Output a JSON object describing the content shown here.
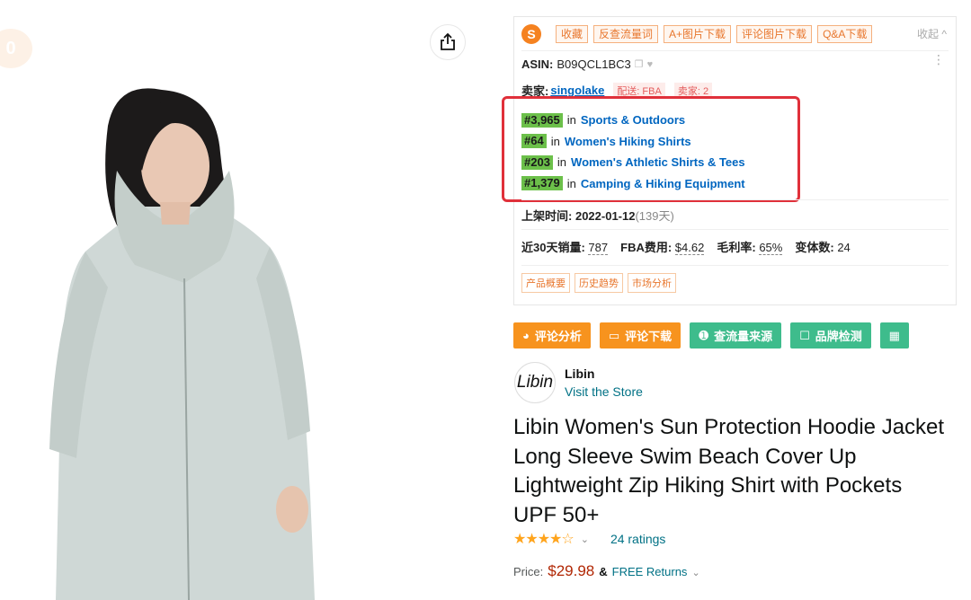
{
  "left": {
    "corner_badge": "0",
    "share_icon": "share-icon"
  },
  "plugin": {
    "logo": "S",
    "tools": [
      "收藏",
      "反查流量词",
      "A+图片下载",
      "评论图片下载",
      "Q&A下载"
    ],
    "collapse": "收起 ^",
    "asin_label": "ASIN:",
    "asin": "B09QCL1BC3",
    "seller_label": "卖家:",
    "seller": "singolake",
    "ship_tag": "配送: FBA",
    "sellers_tag": "卖家: 2",
    "ranks": [
      {
        "num": "#3,965",
        "in": "in",
        "cat": "Sports & Outdoors"
      },
      {
        "num": "#64",
        "in": "in",
        "cat": "Women's Hiking Shirts"
      },
      {
        "num": "#203",
        "in": "in",
        "cat": "Women's Athletic Shirts & Tees"
      },
      {
        "num": "#1,379",
        "in": "in",
        "cat": "Camping & Hiking Equipment"
      }
    ],
    "list_date_label": "上架时间:",
    "list_date": "2022-01-12",
    "list_days": "(139天)",
    "stats": [
      {
        "k": "近30天销量:",
        "v": "787"
      },
      {
        "k": "FBA费用:",
        "v": "$4.62"
      },
      {
        "k": "毛利率:",
        "v": "65%"
      },
      {
        "k": "变体数:",
        "v": "24"
      }
    ],
    "tabs": [
      "产品概要",
      "历史趋势",
      "市场分析"
    ]
  },
  "actions": {
    "review_analysis": "评论分析",
    "review_download": "评论下载",
    "traffic_source": "查流量来源",
    "brand_check": "品牌检测"
  },
  "brand": {
    "logo_text": "Libin",
    "name": "Libin",
    "visit": "Visit the Store"
  },
  "product": {
    "title": "Libin Women's Sun Protection Hoodie Jacket Long Sleeve Swim Beach Cover Up Lightweight Zip Hiking Shirt with Pockets UPF 50+",
    "rating": 4.5,
    "stars_glyph": "★★★★☆",
    "ratings_text": "24 ratings",
    "price_label": "Price:",
    "price": "$29.98",
    "amp": "&",
    "returns": "FREE Returns"
  },
  "colors": {
    "accent_orange": "#f7931e",
    "accent_green": "#3ebc8c",
    "rank_green": "#6cc04a",
    "link_blue": "#0066c0",
    "price_red": "#b12704",
    "highlight_red": "#e0303a"
  }
}
